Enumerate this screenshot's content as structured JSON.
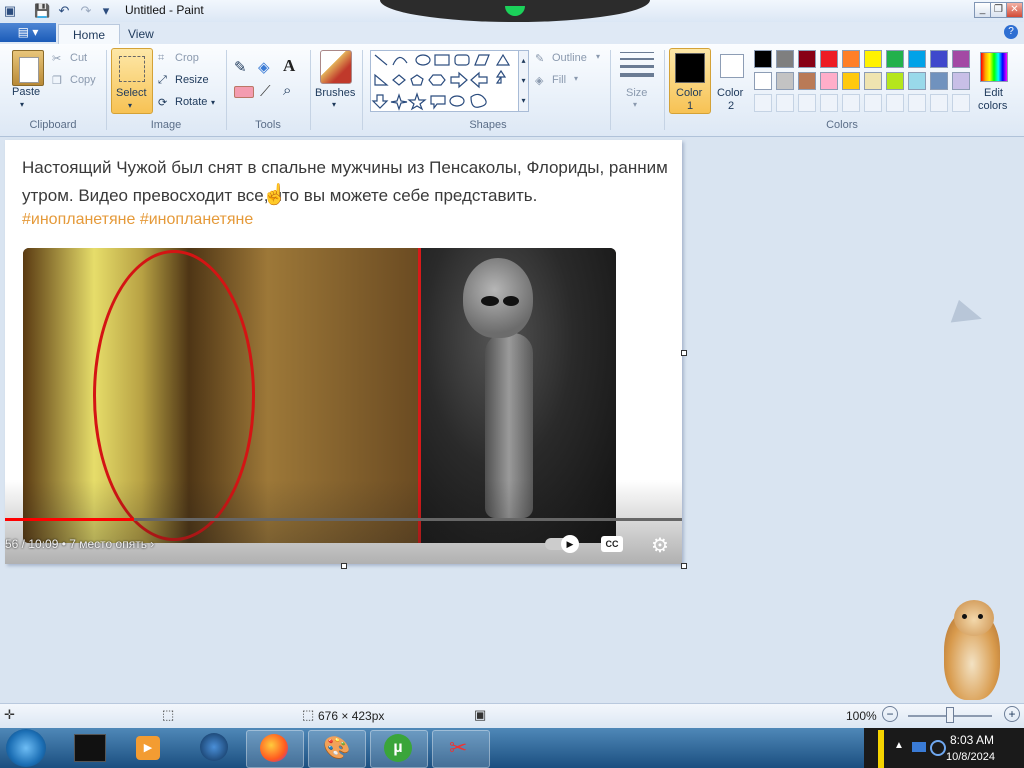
{
  "window": {
    "title": "Untitled - Paint"
  },
  "tabs": {
    "file_label": "▤ ▾",
    "home": "Home",
    "view": "View"
  },
  "clipboard": {
    "paste": "Paste",
    "cut": "Cut",
    "copy": "Copy",
    "group": "Clipboard"
  },
  "image": {
    "select": "Select",
    "crop": "Crop",
    "resize": "Resize",
    "rotate": "Rotate",
    "group": "Image"
  },
  "tools": {
    "group": "Tools"
  },
  "brushes": {
    "label": "Brushes"
  },
  "shapes": {
    "outline": "Outline",
    "fill": "Fill",
    "group": "Shapes"
  },
  "size": {
    "label": "Size"
  },
  "colors": {
    "color1": "Color\n1",
    "color1_a": "Color",
    "color1_b": "1",
    "color2_a": "Color",
    "color2_b": "2",
    "edit": "Edit",
    "edit_b": "colors",
    "group": "Colors",
    "palette_row1": [
      "#000000",
      "#7f7f7f",
      "#880015",
      "#ed1c24",
      "#ff7f27",
      "#fff200",
      "#22b14c",
      "#00a2e8",
      "#3f48cc",
      "#a349a4"
    ],
    "palette_row2": [
      "#ffffff",
      "#c3c3c3",
      "#b97a57",
      "#ffaec9",
      "#ffc90e",
      "#efe4b0",
      "#b5e61d",
      "#99d9ea",
      "#7092be",
      "#c8bfe7"
    ]
  },
  "canvas": {
    "post_text": "Настоящий Чужой был снят в спальне мужчины из Пенсаколы, Флориды, ранним утром. Видео превосходит все, что вы можете себе представить.",
    "hashtags": "#инопланетяне #инопланетяне",
    "timestamp": "56 / 10:09  •  7 место опять  ›",
    "cc": "CC",
    "video_progress": 0.19
  },
  "statusbar": {
    "dimensions": "676 × 423px",
    "zoom": "100%"
  },
  "taskbar": {
    "time": "8:03 AM",
    "date": "10/8/2024"
  }
}
